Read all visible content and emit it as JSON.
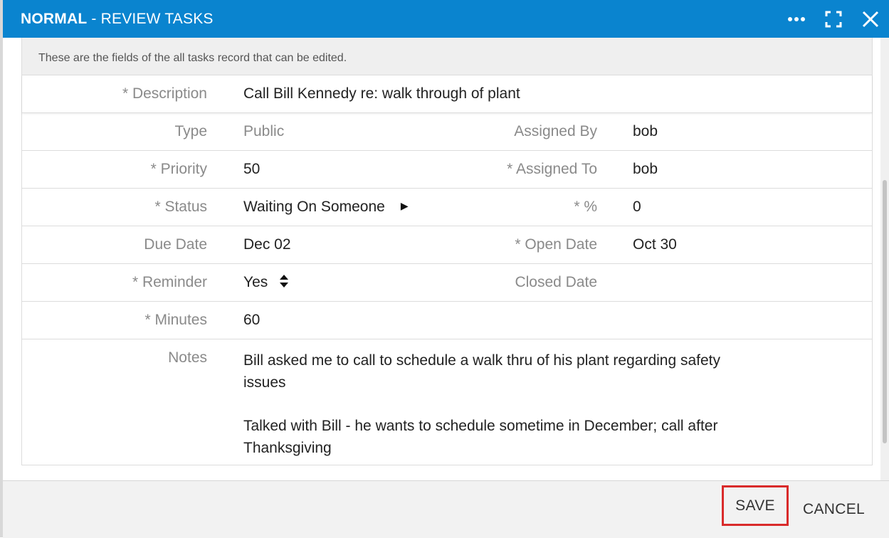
{
  "titlebar": {
    "mode": "NORMAL",
    "separator": " - ",
    "title": "REVIEW TASKS",
    "actions": [
      {
        "icon": "more-icon"
      },
      {
        "icon": "expand-icon"
      },
      {
        "icon": "close-icon"
      }
    ],
    "color": "#0a84cf"
  },
  "form": {
    "info_text": "These are the fields of the all tasks record that can be edited.",
    "description": {
      "label": "* Description",
      "value": "Call Bill Kennedy re: walk through of plant"
    },
    "type": {
      "label": "Type",
      "value": "Public"
    },
    "assigned_by": {
      "label": "Assigned By",
      "value": "bob"
    },
    "priority": {
      "label": "* Priority",
      "value": "50"
    },
    "assigned_to": {
      "label": "* Assigned To",
      "value": "bob"
    },
    "status": {
      "label": "* Status",
      "value": "Waiting On Someone",
      "icon": "caret-right-icon"
    },
    "percent": {
      "label": "* %",
      "value": "0"
    },
    "due_date": {
      "label": "Due Date",
      "value": "Dec 02"
    },
    "open_date": {
      "label": "* Open Date",
      "value": "Oct 30"
    },
    "reminder": {
      "label": "* Reminder",
      "value": "Yes",
      "icon": "sort-updown-icon"
    },
    "closed_date": {
      "label": "Closed Date",
      "value": ""
    },
    "minutes": {
      "label": "* Minutes",
      "value": "60"
    },
    "notes": {
      "label": "Notes",
      "paragraph1": "Bill asked me to call to schedule a walk thru of his plant regarding safety issues",
      "paragraph2": "Talked with Bill - he wants to schedule sometime in December; call after Thanksgiving"
    }
  },
  "footer": {
    "save_label": "SAVE",
    "cancel_label": "CANCEL",
    "highlight_color": "#d92b2b"
  }
}
